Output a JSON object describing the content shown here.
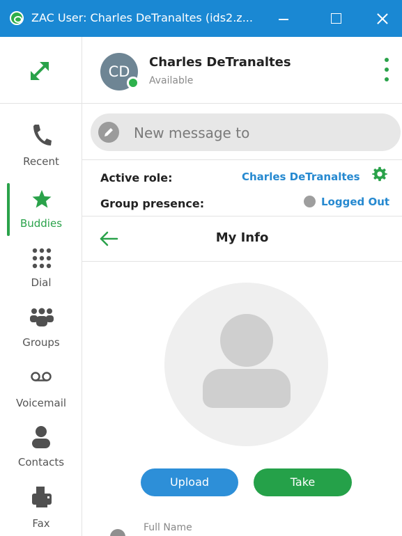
{
  "window": {
    "title": "ZAC User: Charles DeTranaltes (ids2.z..."
  },
  "nav": {
    "items": [
      {
        "label": "Recent",
        "icon": "phone-icon"
      },
      {
        "label": "Buddies",
        "icon": "star-icon",
        "active": true
      },
      {
        "label": "Dial",
        "icon": "dialpad-icon"
      },
      {
        "label": "Groups",
        "icon": "group-icon"
      },
      {
        "label": "Voicemail",
        "icon": "voicemail-icon"
      },
      {
        "label": "Contacts",
        "icon": "contact-icon"
      },
      {
        "label": "Fax",
        "icon": "fax-icon"
      }
    ]
  },
  "user": {
    "initials": "CD",
    "name": "Charles DeTranaltes",
    "status": "Available"
  },
  "compose": {
    "placeholder": "New message to"
  },
  "role": {
    "active_label": "Active role:",
    "active_value": "Charles DeTranaltes",
    "presence_label": "Group presence:",
    "presence_value": "Logged Out"
  },
  "page": {
    "title": "My Info"
  },
  "photo": {
    "upload_label": "Upload",
    "take_label": "Take"
  },
  "fields": {
    "full_name_label": "Full Name"
  },
  "colors": {
    "titlebar": "#1a88d3",
    "accent_green": "#2aa24a",
    "link_blue": "#2689d0"
  }
}
